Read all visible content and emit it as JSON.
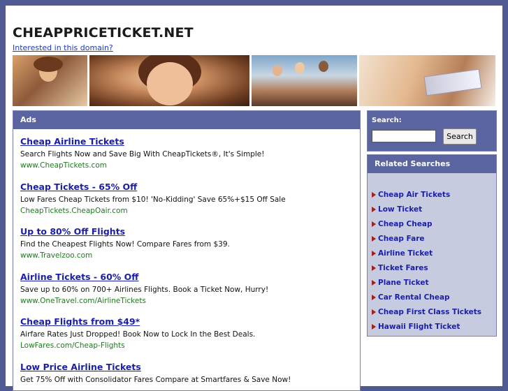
{
  "header": {
    "site_title": "CHEAPPRICETICKET.NET",
    "domain_link": "Interested in this domain?"
  },
  "ads": {
    "heading": "Ads",
    "items": [
      {
        "title": "Cheap Airline Tickets",
        "description": "Search Flights Now and Save Big With CheapTickets®, It's Simple!",
        "url": "www.CheapTickets.com"
      },
      {
        "title": "Cheap Tickets - 65% Off",
        "description": "Low Fares Cheap Tickets from $10! 'No-Kidding' Save 65%+$15 Off Sale",
        "url": "CheapTickets.CheapOair.com"
      },
      {
        "title": "Up to 80% Off Flights",
        "description": "Find the Cheapest Flights Now! Compare Fares from $39.",
        "url": "www.Travelzoo.com"
      },
      {
        "title": "Airline Tickets - 60% Off",
        "description": "Save up to 60% on 700+ Airlines Flights. Book a Ticket Now, Hurry!",
        "url": "www.OneTravel.com/AirlineTickets"
      },
      {
        "title": "Cheap Flights from $49*",
        "description": "Airfare Rates Just Dropped! Book Now to Lock In the Best Deals.",
        "url": "LowFares.com/Cheap-Flights"
      },
      {
        "title": "Low Price Airline Tickets",
        "description": "Get 75% Off with Consolidator Fares Compare at Smartfares & Save Now!",
        "url": ""
      }
    ]
  },
  "search": {
    "label": "Search:",
    "input_value": "",
    "button_label": "Search"
  },
  "related": {
    "heading": "Related Searches",
    "items": [
      "Cheap Air Tickets",
      "Low Ticket",
      "Cheap Cheap",
      "Cheap Fare",
      "Airline Ticket",
      "Ticket Fares",
      "Plane Ticket",
      "Car Rental Cheap",
      "Cheap First Class Tickets",
      "Hawaii Flight Ticket"
    ]
  },
  "colors": {
    "page_background": "#4f5a92",
    "header_bar": "#5a64a0",
    "sidebar_panel": "#c7cbe0",
    "ad_title": "#1a1fa8",
    "ad_url": "#1f7a1f",
    "bullet_arrow": "#a0201a"
  }
}
